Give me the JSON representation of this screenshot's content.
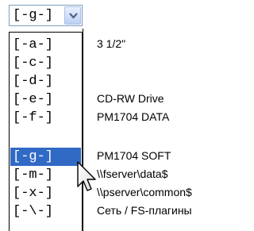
{
  "combo": {
    "value": "[-g-]"
  },
  "drives": [
    {
      "letter": "[-a-]",
      "label": "3 1/2\""
    },
    {
      "letter": "[-c-]",
      "label": ""
    },
    {
      "letter": "[-d-]",
      "label": ""
    },
    {
      "letter": "[-e-]",
      "label": "CD-RW Drive"
    },
    {
      "letter": "[-f-]",
      "label": "PM1704 DATA"
    },
    {
      "letter": "[-g-]",
      "label": "PM1704 SOFT",
      "selected": true
    },
    {
      "letter": "[-m-]",
      "label": "\\\\fserver\\data$"
    },
    {
      "letter": "[-x-]",
      "label": "\\\\pserver\\common$"
    },
    {
      "letter": "[-\\-]",
      "label": "Сеть / FS-плагины"
    }
  ],
  "icons": {
    "dropdown": "chevron-down-icon",
    "cursor": "mouse-pointer-icon"
  }
}
